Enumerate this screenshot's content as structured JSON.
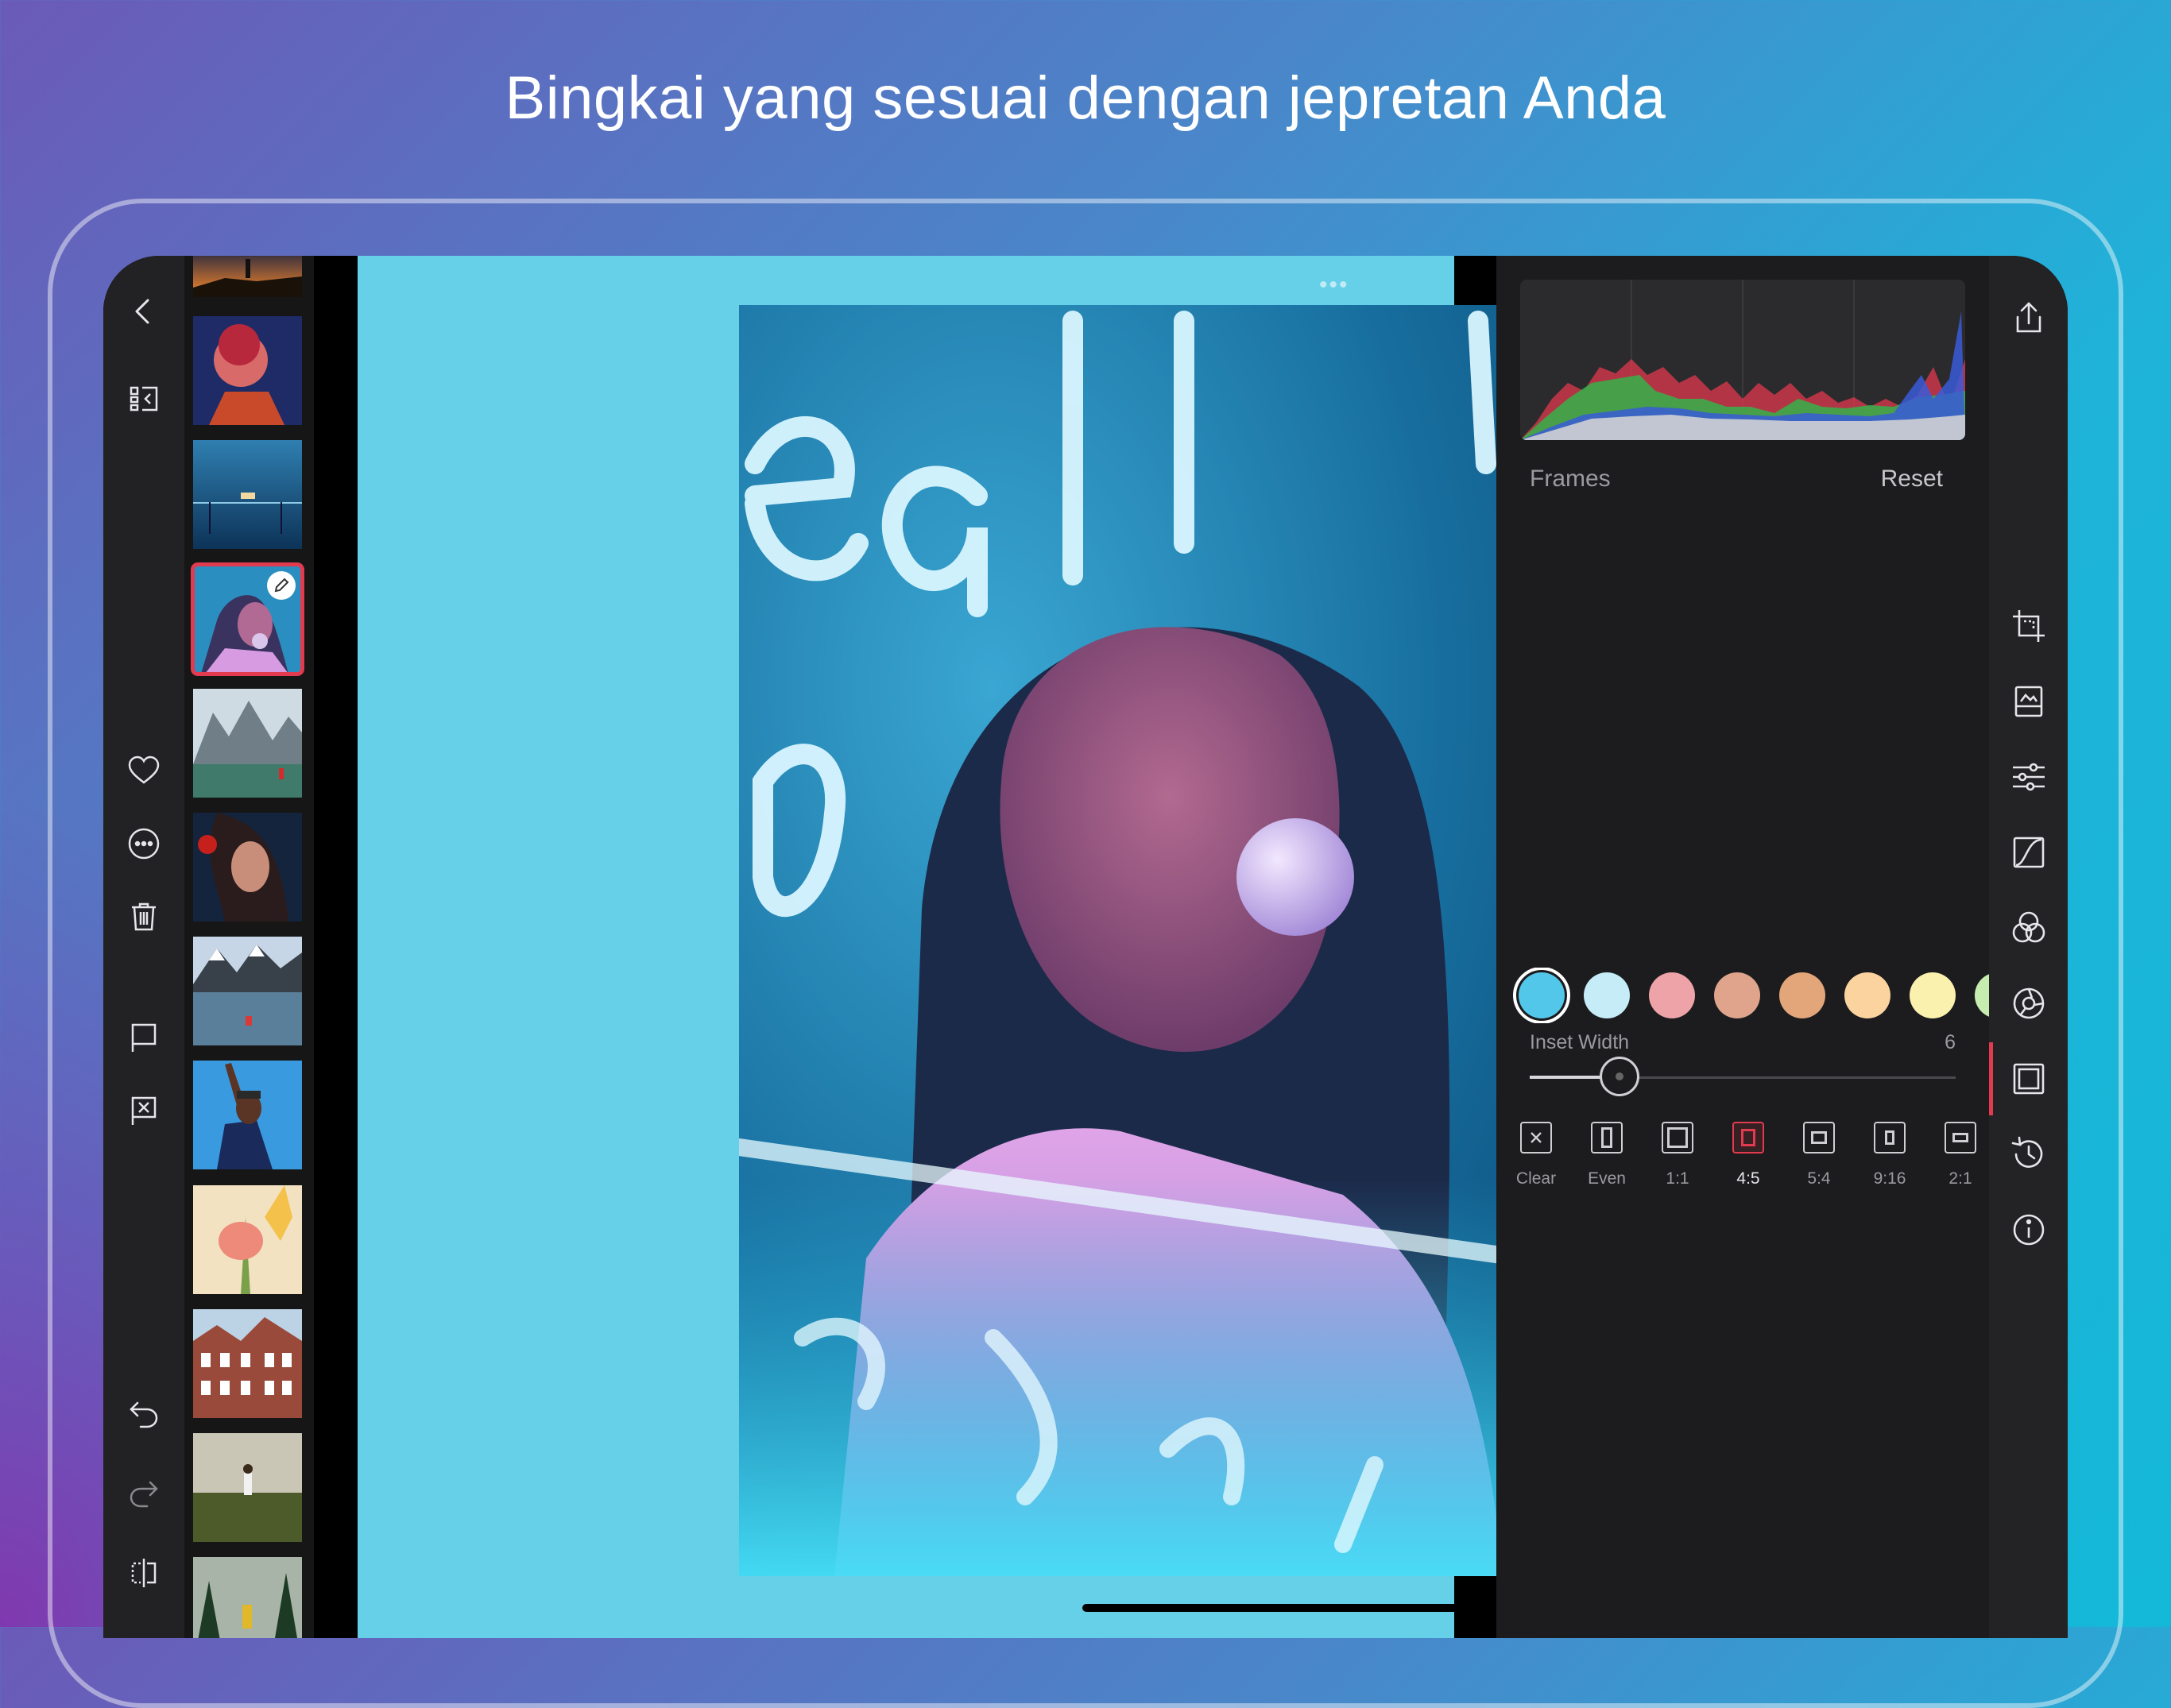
{
  "headline": "Bingkai yang sesuai dengan jepretan Anda",
  "canvas": {
    "background": "#65d0e8",
    "drag_handle": "•••"
  },
  "panel": {
    "section_title": "Frames",
    "reset_label": "Reset",
    "inset_width_label": "Inset Width",
    "inset_width_value": "6",
    "inset_width_fraction": 0.21,
    "swatches": [
      "#53c7ea",
      "#c6ecf8",
      "#eea3a8",
      "#e0a48c",
      "#e3a57a",
      "#fbd39e",
      "#fbf1ae",
      "#c7ecb0"
    ],
    "selected_swatch": 0,
    "ratios": [
      {
        "label": "Clear",
        "icon": "clear-icon"
      },
      {
        "label": "Even",
        "icon": "frame-even-icon"
      },
      {
        "label": "1:1",
        "icon": "frame-1-1-icon"
      },
      {
        "label": "4:5",
        "icon": "frame-4-5-icon",
        "active": true
      },
      {
        "label": "5:4",
        "icon": "frame-5-4-icon"
      },
      {
        "label": "9:16",
        "icon": "frame-9-16-icon"
      },
      {
        "label": "2:1",
        "icon": "frame-2-1-icon"
      }
    ]
  },
  "left_tools": [
    "back-icon",
    "library-icon",
    "heart-icon",
    "more-icon",
    "trash-icon",
    "flag-icon",
    "reject-flag-icon",
    "undo-icon",
    "redo-icon",
    "compare-icon"
  ],
  "right_tools": [
    "export-icon",
    "crop-icon",
    "presets-icon",
    "adjustments-icon",
    "curves-icon",
    "color-mix-icon",
    "lens-icon",
    "frames-icon",
    "history-icon",
    "info-icon"
  ],
  "accent_color": "#e23a4e"
}
